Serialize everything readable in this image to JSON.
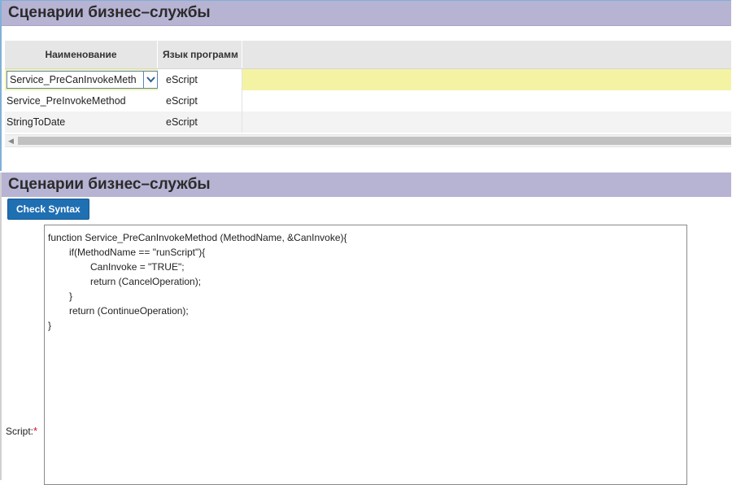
{
  "list_applet": {
    "title": "Сценарии бизнес–службы",
    "columns": [
      "Наименование",
      "Язык программ"
    ],
    "rows": [
      {
        "name": "Service_PreCanInvokeMeth",
        "language": "eScript"
      },
      {
        "name": "Service_PreInvokeMethod",
        "language": "eScript"
      },
      {
        "name": "StringToDate",
        "language": "eScript"
      }
    ]
  },
  "form_applet": {
    "title": "Сценарии бизнес–службы",
    "check_syntax_label": "Check Syntax",
    "script_label": "Script:",
    "required_marker": "*",
    "code_lines": [
      "function Service_PreCanInvokeMethod (MethodName, &CanInvoke){",
      "if(MethodName == \"runScript\"){",
      "CanInvoke = \"TRUE\";",
      "return (CancelOperation);",
      "}",
      "return (ContinueOperation);",
      "}"
    ]
  },
  "colors": {
    "title_bar": "#b7b3d3",
    "selected_row": "#f4f3a4",
    "button": "#1f6fb3",
    "required": "#d0102a"
  }
}
